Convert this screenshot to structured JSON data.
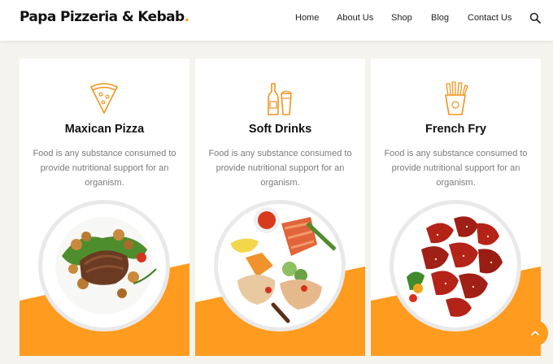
{
  "header": {
    "logo": "Papa Pizzeria & Kebab",
    "logo_dot": ".",
    "nav": [
      "Home",
      "About Us",
      "Shop",
      "Blog",
      "Contact Us"
    ],
    "search_icon": "search-icon"
  },
  "cards": [
    {
      "icon": "pizza-slice-icon",
      "title": "Maxican Pizza",
      "description": "Food is any substance consumed to provide nutritional support for an organism.",
      "image": "steak-plate"
    },
    {
      "icon": "drinks-icon",
      "title": "Soft Drinks",
      "description": "Food is any substance consumed to provide nutritional support for an organism.",
      "image": "platter-plate"
    },
    {
      "icon": "french-fries-icon",
      "title": "French Fry",
      "description": "Food is any substance consumed to provide nutritional support for an organism.",
      "image": "chicken-wings-plate"
    }
  ],
  "back_to_top_icon": "chevron-up-icon",
  "colors": {
    "accent": "#ff9b1f",
    "text": "#111111",
    "muted": "#7b7b7b",
    "page_bg": "#f4f3ee"
  }
}
